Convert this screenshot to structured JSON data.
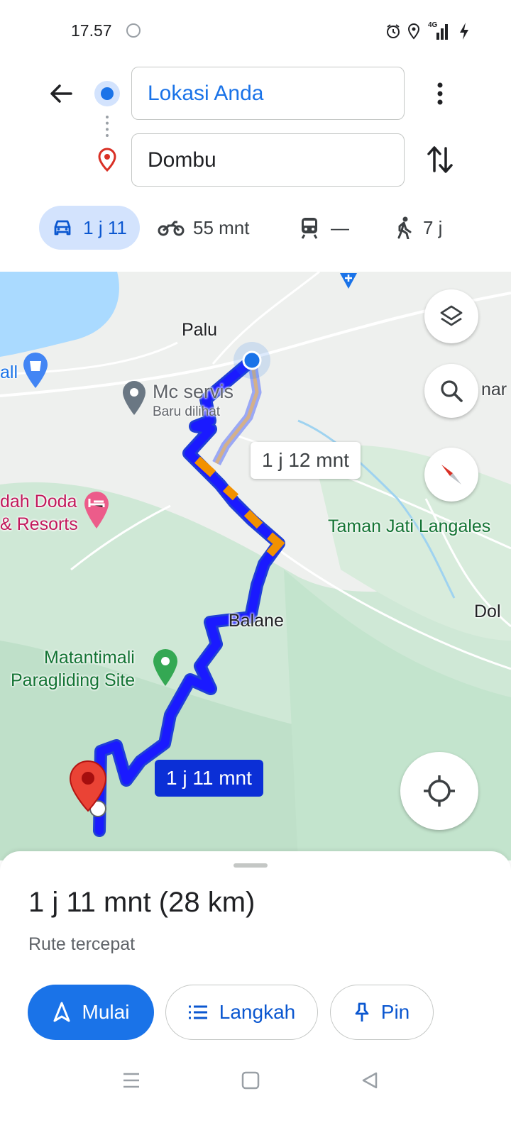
{
  "status_bar": {
    "time": "17.57",
    "network": "4G"
  },
  "directions": {
    "origin": "Lokasi Anda",
    "destination": "Dombu"
  },
  "modes": [
    {
      "name": "car",
      "label": "1 j 11",
      "selected": true
    },
    {
      "name": "motorcycle",
      "label": "55 mnt"
    },
    {
      "name": "transit",
      "label": "—"
    },
    {
      "name": "walk",
      "label": "7 j"
    }
  ],
  "map": {
    "places": {
      "palu": "Palu",
      "mc_servis": "Mc servis",
      "mc_servis_sub": "Baru dilihat",
      "mall_partial": "all",
      "resort_line1": "dah Doda",
      "resort_line2": "& Resorts",
      "taman_jati": "Taman Jati Langales",
      "balane": "Balane",
      "matantimali_line1": "Matantimali",
      "matantimali_line2": "Paragliding Site",
      "right_partial_top": "nar",
      "right_partial_mid": "Dol"
    },
    "alt_route_time": "1 j 12 mnt",
    "main_route_time": "1 j 11 mnt",
    "colors": {
      "route": "#1a1aff",
      "route_dark": "#1f3fd6",
      "traffic": "#f29100",
      "water": "#aadaff",
      "land": "#e8f0ea",
      "green": "#c4e6cf"
    }
  },
  "sheet": {
    "summary": "1 j 11 mnt (28 km)",
    "subtitle": "Rute tercepat",
    "start_label": "Mulai",
    "steps_label": "Langkah",
    "pin_label": "Pin"
  }
}
